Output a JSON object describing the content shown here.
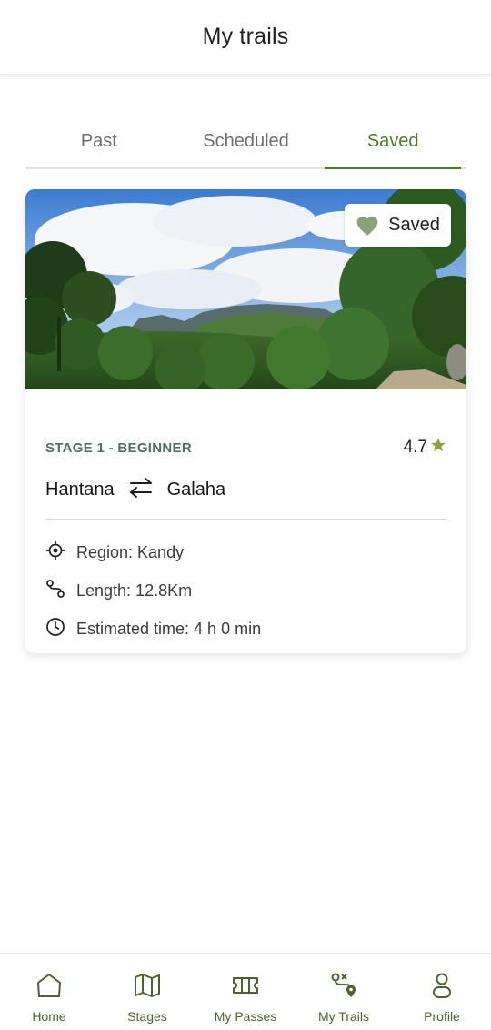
{
  "header": {
    "title": "My trails"
  },
  "tabs": [
    {
      "label": "Past",
      "active": false
    },
    {
      "label": "Scheduled",
      "active": false
    },
    {
      "label": "Saved",
      "active": true
    }
  ],
  "card": {
    "badge_label": "Saved",
    "stage_label": "STAGE 1 - BEGINNER",
    "rating": "4.7",
    "route": {
      "from": "Hantana",
      "to": "Galaha"
    },
    "region": "Region: Kandy",
    "length": "Length: 12.8Km",
    "time": "Estimated time: 4 h 0 min"
  },
  "bottom_nav": [
    {
      "label": "Home",
      "icon": "home-icon"
    },
    {
      "label": "Stages",
      "icon": "map-icon"
    },
    {
      "label": "My Passes",
      "icon": "ticket-icon"
    },
    {
      "label": "My Trails",
      "icon": "route-icon"
    },
    {
      "label": "Profile",
      "icon": "profile-icon"
    }
  ],
  "colors": {
    "accent": "#4e7a2a",
    "nav_icon": "#4b6330",
    "star": "#8aa23a",
    "heart": "#8aa27a",
    "stage_label": "#54705a"
  }
}
